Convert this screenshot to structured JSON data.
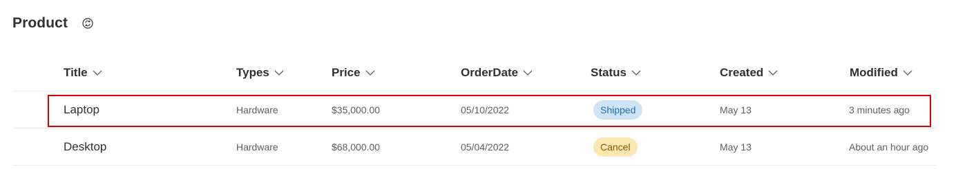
{
  "list": {
    "title": "Product"
  },
  "columns": [
    {
      "label": "Title"
    },
    {
      "label": "Types"
    },
    {
      "label": "Price"
    },
    {
      "label": "OrderDate"
    },
    {
      "label": "Status"
    },
    {
      "label": "Created"
    },
    {
      "label": "Modified"
    }
  ],
  "rows": [
    {
      "title": "Laptop",
      "types": "Hardware",
      "price": "$35,000.00",
      "order_date": "05/10/2022",
      "status": "Shipped",
      "created": "May 13",
      "modified": "3 minutes ago"
    },
    {
      "title": "Desktop",
      "types": "Hardware",
      "price": "$68,000.00",
      "order_date": "05/04/2022",
      "status": "Cancel",
      "created": "May 13",
      "modified": "About an hour ago"
    }
  ],
  "colors": {
    "shipped_bg": "#cfe4f7",
    "shipped_text": "#1f6fb2",
    "cancel_bg": "#fde7b0",
    "cancel_text": "#8a5a00",
    "highlight": "#e00000"
  },
  "icons": {
    "sync": "sync-icon",
    "sort": "chevron-down-icon"
  }
}
